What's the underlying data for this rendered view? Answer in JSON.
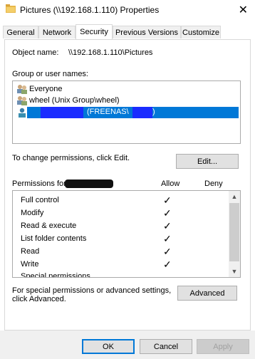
{
  "window": {
    "title": "Pictures (\\\\192.168.1.110) Properties",
    "close_glyph": "✕"
  },
  "tabs": [
    {
      "label": "General"
    },
    {
      "label": "Network"
    },
    {
      "label": "Security"
    },
    {
      "label": "Previous Versions"
    },
    {
      "label": "Customize"
    }
  ],
  "security": {
    "object_name_label": "Object name:",
    "object_name_value": "\\\\192.168.1.110\\Pictures",
    "group_label": "Group or user names:",
    "users": [
      {
        "name": "Everyone",
        "icon": "group-icon"
      },
      {
        "name": "wheel (Unix Group\\wheel)",
        "icon": "group-icon"
      },
      {
        "name": "(FREENAS\\",
        "suffix": ")",
        "icon": "user-icon"
      }
    ],
    "change_text": "To change permissions, click Edit.",
    "edit_button": "Edit...",
    "permissions_for_label": "Permissions for",
    "allow_label": "Allow",
    "deny_label": "Deny",
    "permissions": [
      {
        "name": "Full control",
        "allow": true
      },
      {
        "name": "Modify",
        "allow": true
      },
      {
        "name": "Read & execute",
        "allow": true
      },
      {
        "name": "List folder contents",
        "allow": true
      },
      {
        "name": "Read",
        "allow": true
      },
      {
        "name": "Write",
        "allow": true
      },
      {
        "name": "Special permissions",
        "allow": false
      }
    ],
    "check_glyph": "✓",
    "special_text_line1": "For special permissions or advanced settings,",
    "special_text_line2": "click Advanced.",
    "advanced_button": "Advanced"
  },
  "footer": {
    "ok": "OK",
    "cancel": "Cancel",
    "apply": "Apply"
  },
  "colors": {
    "selection": "#0078d7",
    "accent": "#0078d7"
  }
}
